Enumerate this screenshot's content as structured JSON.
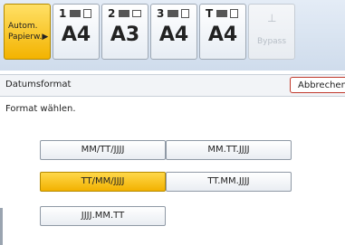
{
  "trays": [
    {
      "kind": "auto",
      "label_line1": "Autom.",
      "label_line2": "Papierw.",
      "arrow": "▶"
    },
    {
      "kind": "tray",
      "number": "1",
      "size": "A4"
    },
    {
      "kind": "tray",
      "number": "2",
      "size": "A3"
    },
    {
      "kind": "tray",
      "number": "3",
      "size": "A4"
    },
    {
      "kind": "tray",
      "number": "T",
      "size": "A4"
    },
    {
      "kind": "bypass",
      "label": "Bypass"
    }
  ],
  "dialog": {
    "title": "Datumsformat",
    "cancel_label": "Abbrechen",
    "instruction": "Format wählen."
  },
  "formats": [
    {
      "label": "MM/TT/JJJJ",
      "selected": false
    },
    {
      "label": "MM.TT.JJJJ",
      "selected": false
    },
    {
      "label": "TT/MM/JJJJ",
      "selected": true
    },
    {
      "label": "TT.MM.JJJJ",
      "selected": false
    },
    {
      "label": "JJJJ.MM.TT",
      "selected": false
    }
  ],
  "colors": {
    "selected": "#f2b100",
    "cancel_border": "#c0392b"
  }
}
